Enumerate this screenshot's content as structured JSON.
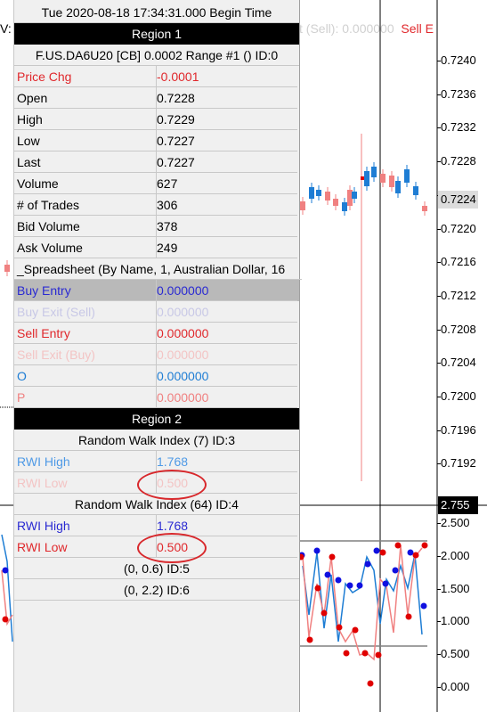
{
  "chart": {
    "header_left": "V:",
    "header_right_faint": "t (Sell): 0.000000",
    "header_right_sell": "Sell E",
    "upper_axis": [
      "0.7240",
      "0.7236",
      "0.7232",
      "0.7228",
      "0.7224",
      "0.7220",
      "0.7216",
      "0.7212",
      "0.7208",
      "0.7204",
      "0.7200",
      "0.7196",
      "0.7192"
    ],
    "upper_current": "0.7224",
    "lower_axis": [
      "2.500",
      "2.000",
      "1.500",
      "1.000",
      "0.500",
      "0.000"
    ],
    "lower_current": "2.755",
    "colors": {
      "up": "#1e7dd4",
      "down": "#f08080",
      "rwi_high": "#1e7dd4",
      "rwi_low": "#f08080",
      "dot_red": "#e00000",
      "dot_blue": "#1010e0"
    }
  },
  "panel": {
    "time_row": "Tue 2020-08-18   17:34:31.000 Begin Time",
    "region1_title": "Region 1",
    "instrument": "F.US.DA6U20 [CB]  0.0002 Range  #1 ()   ID:0",
    "rows": [
      {
        "label": "Price Chg",
        "value": "-0.0001",
        "color": "red"
      },
      {
        "label": "Open",
        "value": "0.7228",
        "color": "black"
      },
      {
        "label": "High",
        "value": "0.7229",
        "color": "black"
      },
      {
        "label": "Low",
        "value": "0.7227",
        "color": "black"
      },
      {
        "label": "Last",
        "value": "0.7227",
        "color": "black"
      },
      {
        "label": "Volume",
        "value": "627",
        "color": "black"
      },
      {
        "label": "# of Trades",
        "value": "306",
        "color": "black"
      },
      {
        "label": "Bid Volume",
        "value": "378",
        "color": "black"
      },
      {
        "label": "Ask Volume",
        "value": "249",
        "color": "black"
      }
    ],
    "spreadsheet_title": "_Spreadsheet (By Name, 1, Australian Dollar, 16",
    "spreadsheet_rows": [
      {
        "label": "Buy Entry",
        "value": "0.000000",
        "color": "blue",
        "selected": true
      },
      {
        "label": "Buy Exit (Sell)",
        "value": "0.000000",
        "color": "faint"
      },
      {
        "label": "Sell Entry",
        "value": "0.000000",
        "color": "red"
      },
      {
        "label": "Sell Exit (Buy)",
        "value": "0.000000",
        "color": "faintred"
      },
      {
        "label": "O",
        "value": "0.000000",
        "color": "lblue"
      },
      {
        "label": "P",
        "value": "0.000000",
        "color": "pink"
      }
    ],
    "region2_title": "Region 2",
    "rwi7_title": "Random Walk Index (7)   ID:3",
    "rwi7_rows": [
      {
        "label": "RWI High",
        "value": "1.768",
        "color": "lightblue"
      },
      {
        "label": "RWI Low",
        "value": "0.500",
        "color": "faintred"
      }
    ],
    "rwi64_title": "Random Walk Index (64)   ID:4",
    "rwi64_rows": [
      {
        "label": "RWI High",
        "value": "1.768",
        "color": "blue"
      },
      {
        "label": "RWI Low",
        "value": "0.500",
        "color": "red"
      }
    ],
    "line1": "(0, 0.6)   ID:5",
    "line2": "(0, 2.2)   ID:6"
  }
}
